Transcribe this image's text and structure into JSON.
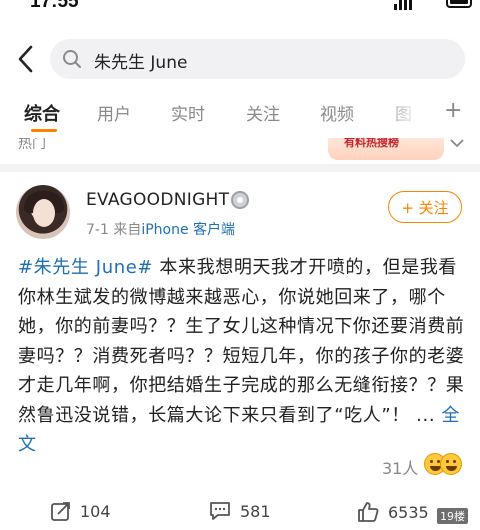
{
  "status_bar": {
    "time": "17:55"
  },
  "search": {
    "query": "朱先生 June"
  },
  "tabs": [
    "综合",
    "用户",
    "实时",
    "关注",
    "视频",
    "图"
  ],
  "subrow": {
    "hot": "热门",
    "banner_text": "有料热搜榜"
  },
  "post": {
    "username": "EVAGOODNIGHT",
    "date": "7-1",
    "source_prefix": "来自",
    "source": "iPhone 客户端",
    "follow_label": "+ 关注",
    "hashtag": "#朱先生 June#",
    "text": " 本来我想明天我才开喷的，但是我看你林生斌发的微博越来越恶心，你说她回来了，哪个她，你的前妻吗？？生了女儿这种情况下你还要消费前妻吗？？消费死者吗？？短短几年，你的孩子你的老婆才走几年啊，你把结婚生子完成的那么无缝衔接？？果然鲁迅没说错，长篇大论下来只看到了“吃人”！ ... ",
    "more_label": "全文",
    "likes_text": "31人"
  },
  "actions": {
    "repost": "104",
    "comment": "581",
    "like": "6535"
  },
  "watermark": "19楼",
  "colors": {
    "accent": "#ff8200",
    "link": "#1f6fb5"
  }
}
